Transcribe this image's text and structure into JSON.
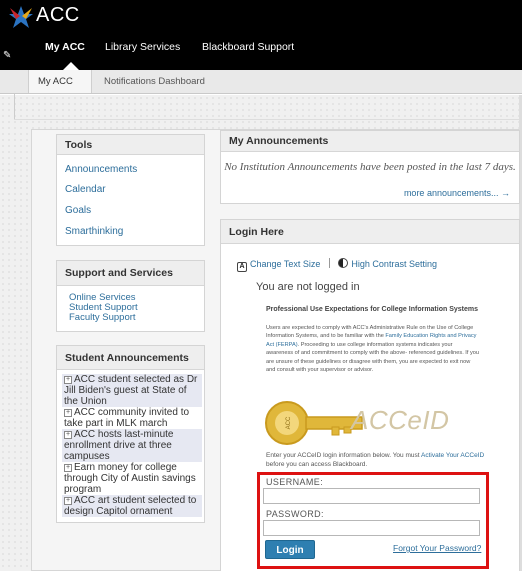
{
  "header": {
    "logo_text": "ACC",
    "nav_tabs": [
      {
        "label": "My ACC",
        "active": true
      },
      {
        "label": "Library Services",
        "active": false
      },
      {
        "label": "Blackboard Support",
        "active": false
      }
    ]
  },
  "subnav": {
    "tabs": [
      {
        "label": "My ACC"
      },
      {
        "label": "Notifications Dashboard"
      }
    ]
  },
  "tools": {
    "title": "Tools",
    "links": [
      "Announcements",
      "Calendar",
      "Goals",
      "Smarthinking"
    ]
  },
  "support": {
    "title": "Support and Services",
    "links": [
      "Online Services",
      "Student Support",
      "Faculty Support"
    ]
  },
  "student_announcements": {
    "title": "Student Announcements",
    "items": [
      "ACC student selected as Dr Jill Biden's guest at State of the Union",
      "ACC community invited to take part in MLK march",
      "ACC hosts last-minute enrollment drive at three campuses",
      "Earn money for college through City of Austin savings program",
      "ACC art student selected to design Capitol ornament"
    ]
  },
  "my_announcements": {
    "title": "My Announcements",
    "empty_text": "No Institution Announcements have been posted in the last 7 days.",
    "more_link": "more announcements... →"
  },
  "login": {
    "title": "Login Here",
    "change_text_size": "Change Text Size",
    "high_contrast": "High Contrast Setting",
    "not_logged_in": "You are not logged in",
    "pue_title": "Professional Use Expectations for College Information Systems",
    "pue_body_1": "Users are expected to comply with ACC's Administrative Rule on the Use of College Information Systems, and to be familiar with the ",
    "pue_body_link": "Family Education Rights and Privacy Act (FERPA)",
    "pue_body_2": ". Proceeding to use college information systems indicates your awareness of and commitment to comply with the above- referenced guidelines. If you are unsure of these guidelines or disagree with them, you are expected to exit now and consult with your supervisor or advisor.",
    "accel_text": "ACCeID",
    "enter_info_1": "Enter your ACCeID login information below. You must ",
    "enter_info_link": "Activate Your ACCeID",
    "enter_info_2": " before you can access Blackboard.",
    "username_label": "USERNAME:",
    "username_value": "",
    "password_label": "PASSWORD:",
    "password_value": "",
    "login_button": "Login",
    "forgot_link": "Forgot Your Password?"
  },
  "colors": {
    "link": "#2d6e9b",
    "highlight_border": "#d11111",
    "login_button": "#2e7fb1",
    "key_gold": "#e0b73a"
  },
  "icons": [
    "logo-star-icon",
    "pencil-icon",
    "text-size-icon",
    "contrast-icon",
    "key-icon",
    "expand-plus-icon"
  ]
}
